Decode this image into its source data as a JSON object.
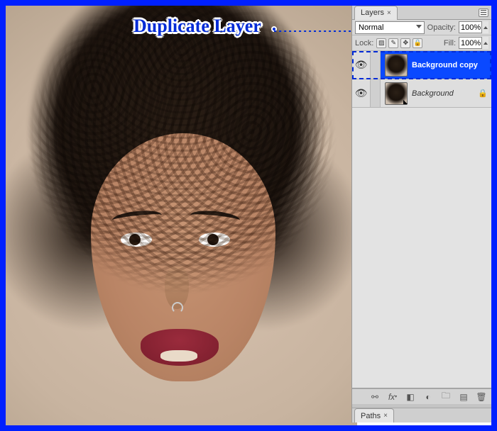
{
  "callout": {
    "label": "Duplicate Layer"
  },
  "panel": {
    "tab_label": "Layers",
    "paths_label": "Paths",
    "blend_mode": "Normal",
    "opacity_label": "Opacity:",
    "opacity_value": "100%",
    "lock_label": "Lock:",
    "fill_label": "Fill:",
    "fill_value": "100%",
    "layers": [
      {
        "name": "Background copy",
        "selected": true,
        "locked": false
      },
      {
        "name": "Background",
        "selected": false,
        "locked": true
      }
    ]
  }
}
